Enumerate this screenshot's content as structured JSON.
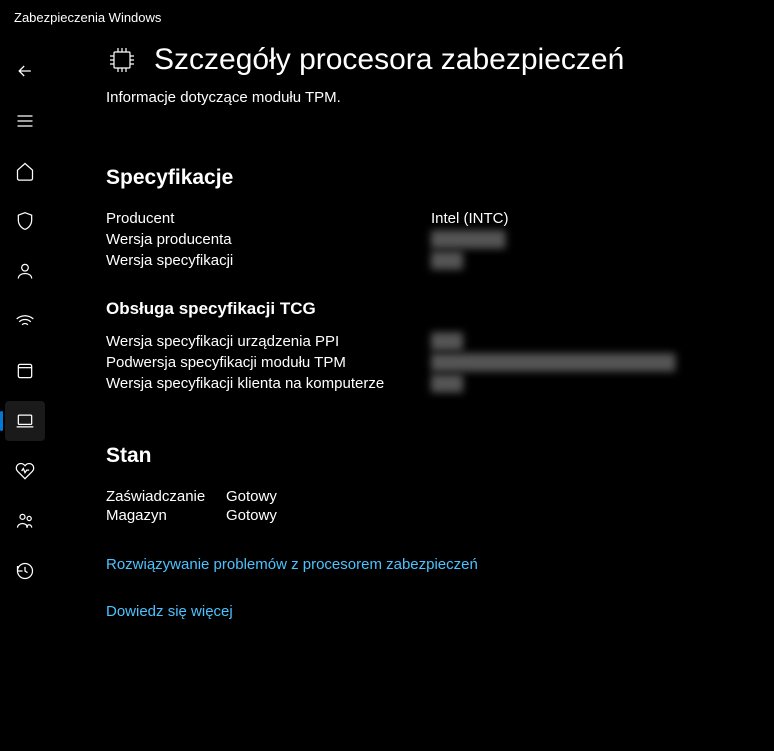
{
  "window": {
    "title": "Zabezpieczenia Windows"
  },
  "page": {
    "title": "Szczegóły procesora zabezpieczeń",
    "subtitle": "Informacje dotyczące modułu TPM."
  },
  "specs": {
    "title": "Specyfikacje",
    "rows": {
      "manufacturer_label": "Producent",
      "manufacturer_value": "Intel (INTC)",
      "mfr_version_label": "Wersja producenta",
      "mfr_version_value": "███████",
      "spec_version_label": "Wersja specyfikacji",
      "spec_version_value": "███"
    },
    "tcg_title": "Obsługa specyfikacji TCG",
    "tcg": {
      "ppi_label": "Wersja specyfikacji urządzenia PPI",
      "ppi_value": "███",
      "tpm_label": "Podwersja specyfikacji modułu TPM",
      "tpm_value": "███████████████████████",
      "client_label": "Wersja specyfikacji klienta na komputerze",
      "client_value": "███"
    }
  },
  "status": {
    "title": "Stan",
    "attestation_label": "Zaświadczanie",
    "attestation_value": "Gotowy",
    "storage_label": "Magazyn",
    "storage_value": "Gotowy"
  },
  "links": {
    "troubleshoot": "Rozwiązywanie problemów z procesorem zabezpieczeń",
    "learn_more": "Dowiedz się więcej"
  }
}
